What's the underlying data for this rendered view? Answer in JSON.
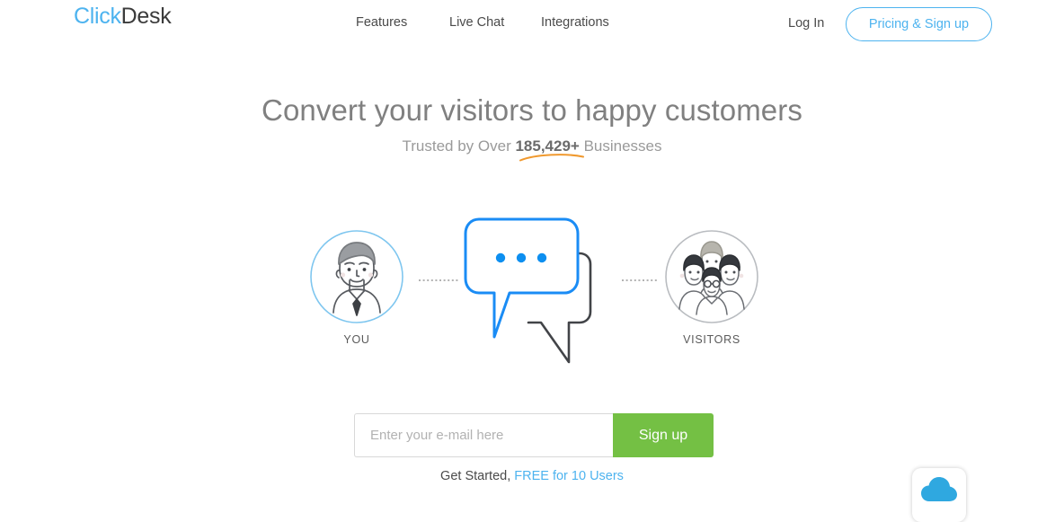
{
  "header": {
    "logo": {
      "part1": "Click",
      "part2": "Desk"
    },
    "nav": [
      {
        "label": "Features",
        "name": "nav-features"
      },
      {
        "label": "Live Chat",
        "name": "nav-live-chat"
      },
      {
        "label": "Integrations",
        "name": "nav-integrations"
      }
    ],
    "login_label": "Log In",
    "pricing_label": "Pricing & Sign up"
  },
  "hero": {
    "headline": "Convert your visitors to happy customers",
    "sub_prefix": "Trusted by Over ",
    "sub_count": "185,429+",
    "sub_suffix": " Businesses"
  },
  "illustration": {
    "you_caption": "YOU",
    "visitors_caption": "VISITORS"
  },
  "signup": {
    "email_placeholder": "Enter your e-mail here",
    "button_label": "Sign up",
    "get_started_prefix": "Get Started, ",
    "free_link": "FREE for 10 Users"
  },
  "colors": {
    "brand_blue": "#4db3ef",
    "bubble_blue": "#0d8ff0",
    "green": "#74c044",
    "orange": "#f0992e",
    "dark_gray": "#4a4a4a"
  }
}
